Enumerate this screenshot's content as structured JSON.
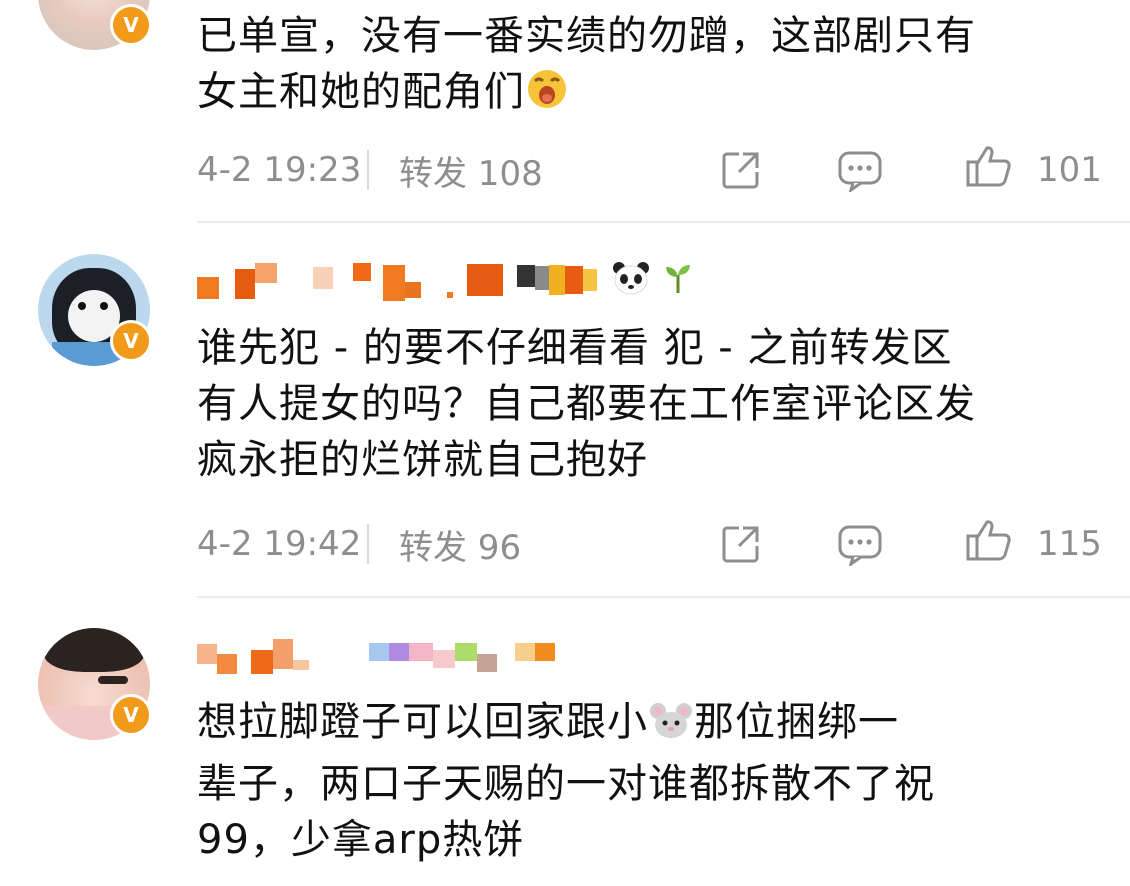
{
  "comments": [
    {
      "text_line1": "已单宣，没有一番实绩的勿蹭，这部剧只有",
      "text_line2": "女主和她的配角们",
      "time": "4-2 19:23",
      "repost_label": "转发 108",
      "like_count": "101",
      "emoji": "face-emoji"
    },
    {
      "text_line1": "谁先犯 - 的要不仔细看看 犯 - 之前转发区",
      "text_line2": "有人提女的吗？自己都要在工作室评论区发",
      "text_line3": "疯永拒的烂饼就自己抱好",
      "time": "4-2 19:42",
      "repost_label": "转发 96",
      "like_count": "115",
      "badges": [
        "panda-emoji",
        "sprout-emoji"
      ]
    },
    {
      "text_line1a": "想拉脚蹬子可以回家跟小",
      "text_line1b": "那位捆绑一",
      "text_line2": "辈子，两口子天赐的一对谁都拆散不了祝",
      "text_line3": "99，少拿arp热饼",
      "emoji": "mouse-emoji"
    }
  ],
  "colors": {
    "text": "#111111",
    "meta": "#8e8e8e",
    "verified_badge": "#f29a1a",
    "divider": "#ebebeb"
  },
  "icons": {
    "share": "share-icon",
    "comment": "comment-icon",
    "like": "thumbs-up-icon",
    "verified": "verified-v-icon"
  }
}
